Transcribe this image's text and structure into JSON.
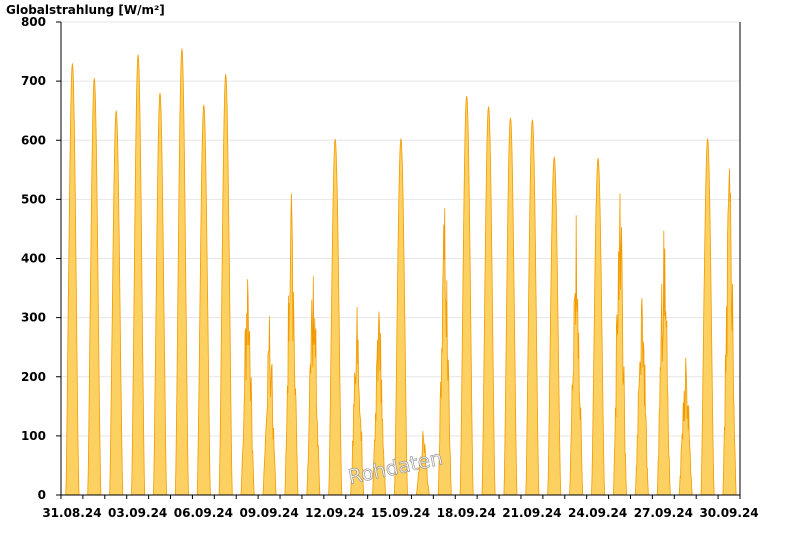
{
  "chart_data": {
    "type": "area",
    "ylabel": "Globalstrahlung [W/m²]",
    "ylim": [
      0,
      800
    ],
    "yticks": [
      0,
      100,
      200,
      300,
      400,
      500,
      600,
      700,
      800
    ],
    "xticks": [
      "31.08.24",
      "03.09.24",
      "06.09.24",
      "09.09.24",
      "12.09.24",
      "15.09.24",
      "18.09.24",
      "21.09.24",
      "24.09.24",
      "27.09.24",
      "30.09.24"
    ],
    "grid": true,
    "series_color": "#fdd161",
    "line_color": "#f29a00",
    "watermark": "Rohdaten",
    "daily_peaks": [
      {
        "date": "31.08.24",
        "peak": 730
      },
      {
        "date": "01.09.24",
        "peak": 705
      },
      {
        "date": "02.09.24",
        "peak": 650
      },
      {
        "date": "03.09.24",
        "peak": 745
      },
      {
        "date": "04.09.24",
        "peak": 680
      },
      {
        "date": "05.09.24",
        "peak": 755
      },
      {
        "date": "06.09.24",
        "peak": 660
      },
      {
        "date": "07.09.24",
        "peak": 712
      },
      {
        "date": "08.09.24",
        "peak": 365
      },
      {
        "date": "09.09.24",
        "peak": 302
      },
      {
        "date": "10.09.24",
        "peak": 510
      },
      {
        "date": "11.09.24",
        "peak": 370
      },
      {
        "date": "12.09.24",
        "peak": 602
      },
      {
        "date": "13.09.24",
        "peak": 318
      },
      {
        "date": "14.09.24",
        "peak": 310
      },
      {
        "date": "15.09.24",
        "peak": 603
      },
      {
        "date": "16.09.24",
        "peak": 108
      },
      {
        "date": "17.09.24",
        "peak": 485
      },
      {
        "date": "18.09.24",
        "peak": 675
      },
      {
        "date": "19.09.24",
        "peak": 657
      },
      {
        "date": "20.09.24",
        "peak": 638
      },
      {
        "date": "21.09.24",
        "peak": 635
      },
      {
        "date": "22.09.24",
        "peak": 572
      },
      {
        "date": "23.09.24",
        "peak": 473
      },
      {
        "date": "24.09.24",
        "peak": 570
      },
      {
        "date": "25.09.24",
        "peak": 510
      },
      {
        "date": "26.09.24",
        "peak": 333
      },
      {
        "date": "27.09.24",
        "peak": 447
      },
      {
        "date": "28.09.24",
        "peak": 232
      },
      {
        "date": "29.09.24",
        "peak": 603
      },
      {
        "date": "30.09.24",
        "peak": 552
      }
    ]
  }
}
